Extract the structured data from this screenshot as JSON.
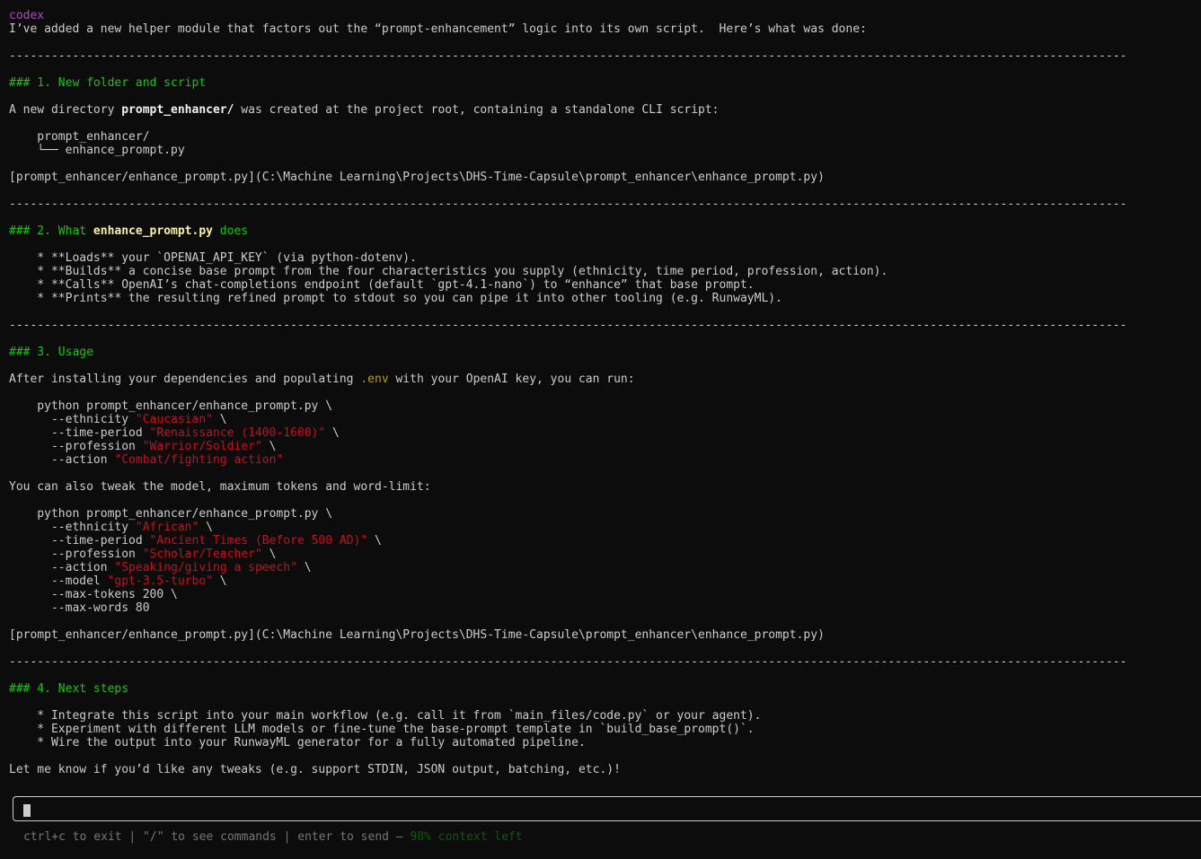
{
  "header": {
    "label": "codex"
  },
  "intro": "I’ve added a new helper module that factors out the “prompt-enhancement” logic into its own script.  Here’s what was done:",
  "rule": "---------------------------------------------------------------------------------------------------------------------------------------------------------------",
  "section1": {
    "heading": "### 1. New folder and script",
    "desc_a": "A new directory ",
    "desc_b": "prompt_enhancer/",
    "desc_c": " was created at the project root, containing a standalone CLI script:",
    "tree_1": "    prompt_enhancer/",
    "tree_2": "    └── enhance_prompt.py",
    "link": "[prompt_enhancer/enhance_prompt.py](C:\\Machine Learning\\Projects\\DHS-Time-Capsule\\prompt_enhancer\\enhance_prompt.py)"
  },
  "section2": {
    "heading_a": "### 2. What ",
    "heading_b": "enhance_prompt.py",
    "heading_c": " does",
    "bullets": [
      "    * **Loads** your `OPENAI_API_KEY` (via python-dotenv).",
      "    * **Builds** a concise base prompt from the four characteristics you supply (ethnicity, time period, profession, action).",
      "    * **Calls** OpenAI’s chat-completions endpoint (default `gpt-4.1-nano`) to “enhance” that base prompt.",
      "    * **Prints** the resulting refined prompt to stdout so you can pipe it into other tooling (e.g. RunwayML)."
    ]
  },
  "section3": {
    "heading": "### 3. Usage",
    "desc_a": "After installing your dependencies and populating ",
    "desc_env": ".env",
    "desc_c": " with your OpenAI key, you can run:",
    "cmd1": {
      "line0": "    python prompt_enhancer/enhance_prompt.py \\",
      "args": [
        {
          "flag": "      --ethnicity ",
          "val": "\"Caucasian\"",
          "tail": " \\"
        },
        {
          "flag": "      --time-period ",
          "val": "\"Renaissance (1400-1600)\"",
          "tail": " \\"
        },
        {
          "flag": "      --profession ",
          "val": "\"Warrior/Soldier\"",
          "tail": " \\"
        },
        {
          "flag": "      --action ",
          "val": "\"Combat/fighting action\"",
          "tail": ""
        }
      ]
    },
    "tweak": "You can also tweak the model, maximum tokens and word-limit:",
    "cmd2": {
      "line0": "    python prompt_enhancer/enhance_prompt.py \\",
      "args": [
        {
          "flag": "      --ethnicity ",
          "val": "\"African\"",
          "tail": " \\"
        },
        {
          "flag": "      --time-period ",
          "val": "\"Ancient Times (Before 500 AD)\"",
          "tail": " \\"
        },
        {
          "flag": "      --profession ",
          "val": "\"Scholar/Teacher\"",
          "tail": " \\"
        },
        {
          "flag": "      --action ",
          "val": "\"Speaking/giving a speech\"",
          "tail": " \\"
        },
        {
          "flag": "      --model ",
          "val": "\"gpt-3.5-turbo\"",
          "tail": " \\"
        }
      ],
      "plain1": "      --max-tokens 200 \\",
      "plain2": "      --max-words 80"
    },
    "link": "[prompt_enhancer/enhance_prompt.py](C:\\Machine Learning\\Projects\\DHS-Time-Capsule\\prompt_enhancer\\enhance_prompt.py)"
  },
  "section4": {
    "heading": "### 4. Next steps",
    "bullets": [
      "    * Integrate this script into your main workflow (e.g. call it from `main_files/code.py` or your agent).",
      "    * Experiment with different LLM models or fine-tune the base-prompt template in `build_base_prompt()`.",
      "    * Wire the output into your RunwayML generator for a fully automated pipeline."
    ]
  },
  "closing": "Let me know if you’d like any tweaks (e.g. support STDIN, JSON output, batching, etc.)!",
  "footer": {
    "hints": "ctrl+c to exit | \"/\" to see commands | enter to send — ",
    "context": "98% context left"
  }
}
